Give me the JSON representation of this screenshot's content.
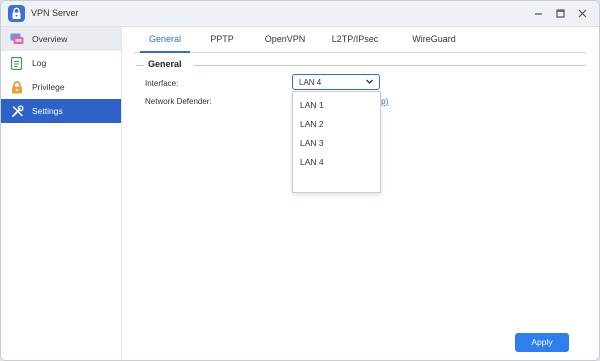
{
  "window": {
    "title": "VPN Server",
    "controls": [
      "minimize-icon",
      "maximize-icon",
      "close-icon"
    ]
  },
  "sidebar": {
    "items": [
      {
        "label": "Overview",
        "icon": "overview-icon",
        "state": "hover"
      },
      {
        "label": "Log",
        "icon": "log-icon",
        "state": "normal"
      },
      {
        "label": "Privilege",
        "icon": "lock-icon",
        "state": "normal"
      },
      {
        "label": "Settings",
        "icon": "wrench-icon",
        "state": "active"
      }
    ]
  },
  "tabs": {
    "items": [
      "General",
      "PPTP",
      "OpenVPN",
      "L2TP/IPsec",
      "WireGuard"
    ],
    "active": "General"
  },
  "general": {
    "section_title": "General",
    "interface_label": "Interface:",
    "interface_value": "LAN 4",
    "interface_options": [
      "LAN 1",
      "LAN 2",
      "LAN 3",
      "LAN 4"
    ],
    "network_defender_label": "Network Defender:",
    "network_defender_link": "etup)"
  },
  "footer": {
    "apply_label": "Apply"
  },
  "colors": {
    "accent": "#2d6fd3",
    "sidebar_active": "#2f62c9",
    "apply_button": "#2d7ff0"
  }
}
